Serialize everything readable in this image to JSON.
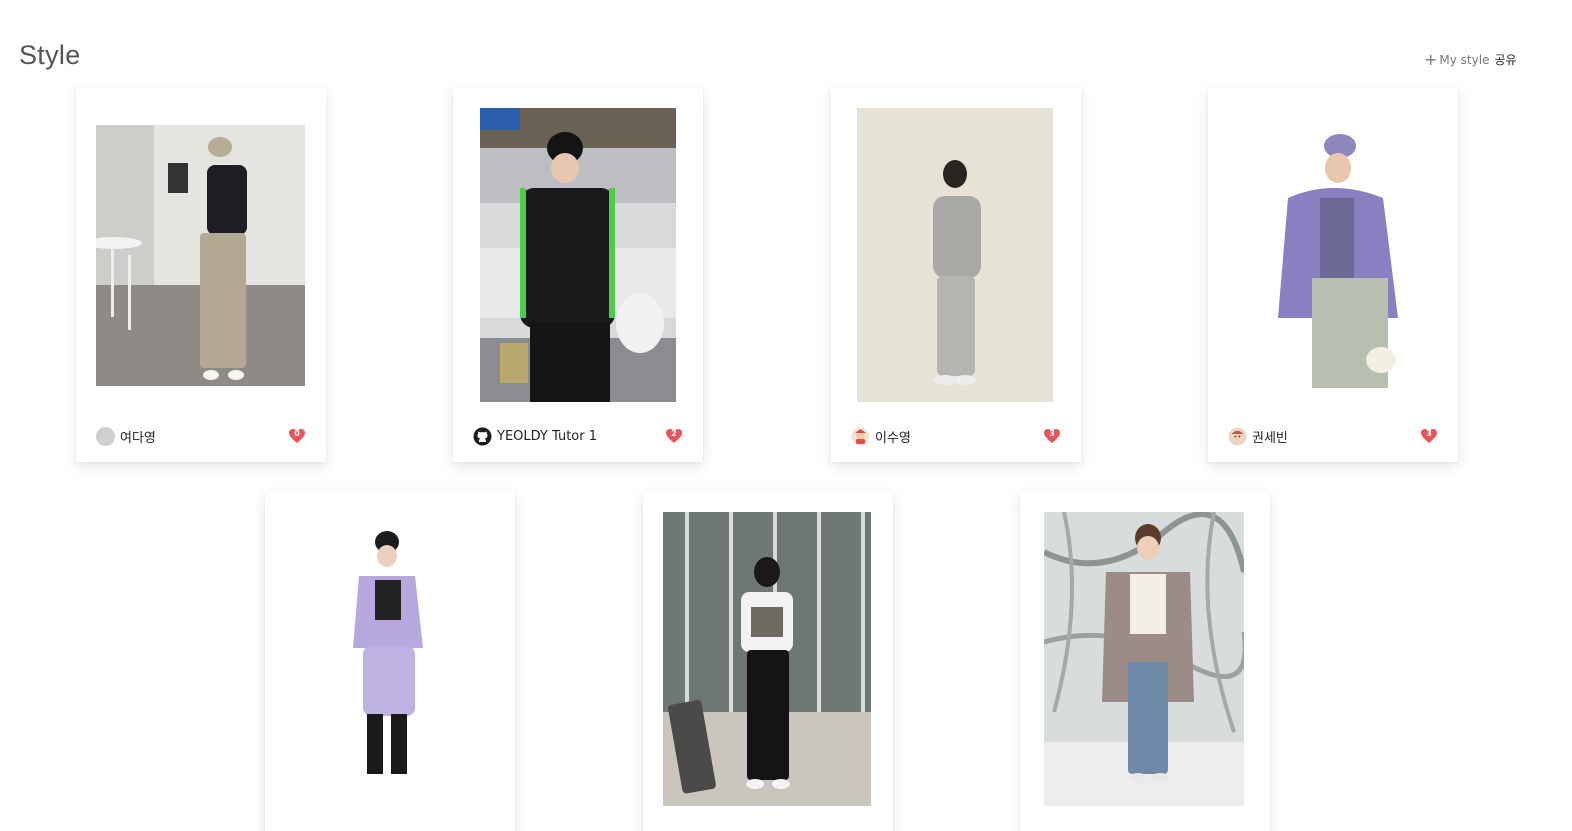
{
  "page": {
    "title": "Style",
    "share_plus": "+",
    "share_label": "My style",
    "share_label_kr": "공유"
  },
  "colors": {
    "like_heart": "#e8545a",
    "default_avatar": "#cfcfcf",
    "card_background": "#ffffff"
  },
  "cards": [
    {
      "author": "여다영",
      "likes": "0",
      "avatar": "default-avatar",
      "photo": "outfit-black-blouse-beige-trousers"
    },
    {
      "author": "YEOLDY Tutor 1",
      "likes": "2",
      "avatar": "github-icon",
      "photo": "outfit-black-track-jacket-truck"
    },
    {
      "author": "이수영",
      "likes": "3",
      "avatar": "character-avatar",
      "photo": "outfit-grey-hoodie-sweatpants"
    },
    {
      "author": "권세빈",
      "likes": "3",
      "avatar": "character-avatar",
      "photo": "outfit-purple-fleece-jacket"
    },
    {
      "author": "",
      "likes": "",
      "avatar": "",
      "photo": "outfit-lavender-track-set"
    },
    {
      "author": "",
      "likes": "",
      "avatar": "",
      "photo": "outfit-white-tee-black-pants"
    },
    {
      "author": "",
      "likes": "",
      "avatar": "",
      "photo": "outfit-pink-coat-jeans"
    }
  ]
}
